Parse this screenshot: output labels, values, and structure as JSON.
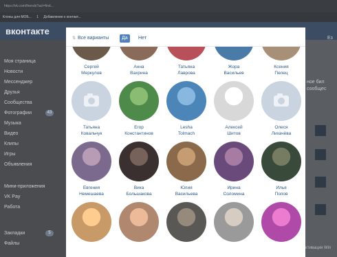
{
  "browser": {
    "url": "https://vk.com/friends?act=find...",
    "bookmarks": [
      "Клоны для МОБ...",
      "1",
      "Добавление к контакт..."
    ]
  },
  "site": {
    "logo": "вконтакте",
    "nav": [
      {
        "label": "Моя страница"
      },
      {
        "label": "Новости"
      },
      {
        "label": "Мессенджер"
      },
      {
        "label": "Друзья"
      },
      {
        "label": "Сообщества"
      },
      {
        "label": "Фотографии",
        "badge": "43"
      },
      {
        "label": "Музыка"
      },
      {
        "label": "Видео"
      },
      {
        "label": "Клипы"
      },
      {
        "label": "Игры"
      },
      {
        "label": "Объявления"
      },
      {
        "label": "Мини-приложения"
      },
      {
        "label": "VK Pay"
      },
      {
        "label": "Работа"
      },
      {
        "label": "Закладки",
        "badge": "5"
      },
      {
        "label": "Файлы"
      }
    ],
    "right_texts": [
      "Ез",
      "ное бил",
      "сообщес"
    ],
    "watermark": "Активация Win"
  },
  "modal": {
    "tabs": {
      "all": "Все варианты",
      "yes": "Да",
      "no": "Нет"
    },
    "people": [
      {
        "first": "Сергей",
        "last": "Меркулов",
        "photo": true,
        "color": "#6b5a4a"
      },
      {
        "first": "Анна",
        "last": "Вахрина",
        "photo": true,
        "color": "#8a6a58"
      },
      {
        "first": "Татьяна",
        "last": "Лаврова",
        "photo": true,
        "color": "#b8505a"
      },
      {
        "first": "Жора",
        "last": "Васильев",
        "photo": true,
        "color": "#4a7aa8"
      },
      {
        "first": "Ксения",
        "last": "Пелец",
        "photo": true,
        "color": "#a89078"
      },
      {
        "first": "Татьяна",
        "last": "Ковальчук",
        "photo": false
      },
      {
        "first": "Егор",
        "last": "Константинов",
        "photo": true,
        "color": "#4e8a4a"
      },
      {
        "first": "Lesha",
        "last": "Tolmach",
        "photo": true,
        "color": "#4c86b8"
      },
      {
        "first": "Алексей",
        "last": "Шитов",
        "photo": true,
        "color": "#d8d8d8"
      },
      {
        "first": "Олеся",
        "last": "Лихачёва",
        "photo": false
      },
      {
        "first": "Евгения",
        "last": "Немешаева",
        "photo": true,
        "color": "#7c6a8e"
      },
      {
        "first": "Вика",
        "last": "Большакова",
        "photo": true,
        "color": "#3a3030"
      },
      {
        "first": "Юлия",
        "last": "Васильева",
        "photo": true,
        "color": "#8a6a4a"
      },
      {
        "first": "Ирина",
        "last": "Соломина",
        "photo": true,
        "color": "#6a4a7a"
      },
      {
        "first": "Илья",
        "last": "Попов",
        "photo": true,
        "color": "#3a4a3a"
      },
      {
        "photo": true,
        "color": "#c89a68"
      },
      {
        "photo": true,
        "color": "#b08870"
      },
      {
        "photo": true,
        "color": "#5a5854"
      },
      {
        "photo": true,
        "color": "#9a9a9a"
      },
      {
        "photo": true,
        "color": "#b04aa8"
      }
    ]
  }
}
